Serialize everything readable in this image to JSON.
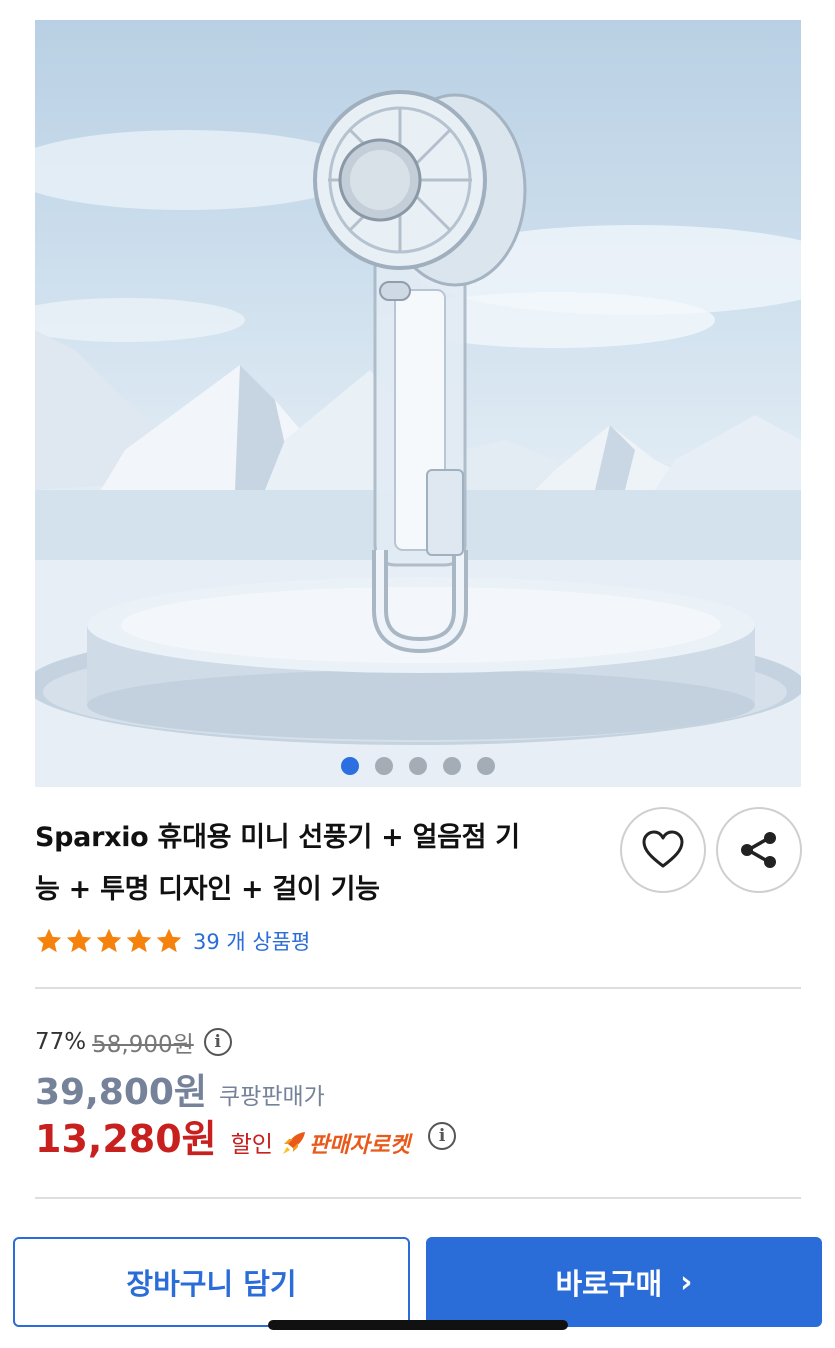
{
  "product": {
    "title_line1": "Sparxio 휴대용 미니 선풍기 + 얼음점 기",
    "title_line2": "능 + 투명 디자인 + 걸이 기능",
    "rating_value": 5,
    "review_count_label": "39 개 상품평"
  },
  "gallery": {
    "image_count": 5,
    "active_index": 0,
    "image_description_icon": "handheld-fan-product-photo"
  },
  "price": {
    "discount_rate": "77%",
    "original_price": "58,900원",
    "sale_price": "39,800원",
    "sale_label": "쿠팡판매가",
    "final_price": "13,280원",
    "final_label": "할인",
    "delivery_badge": "판매자로켓",
    "info_icon_glyph": "i"
  },
  "actions": {
    "add_to_cart": "장바구니 담기",
    "buy_now": "바로구매",
    "buy_now_chevron": "›"
  },
  "colors": {
    "accent_blue": "#2a6dd8",
    "sale_red": "#c8201f",
    "sale_gray": "#75829a",
    "star_orange": "#f5820d",
    "rocket_orange": "#e8591a"
  }
}
